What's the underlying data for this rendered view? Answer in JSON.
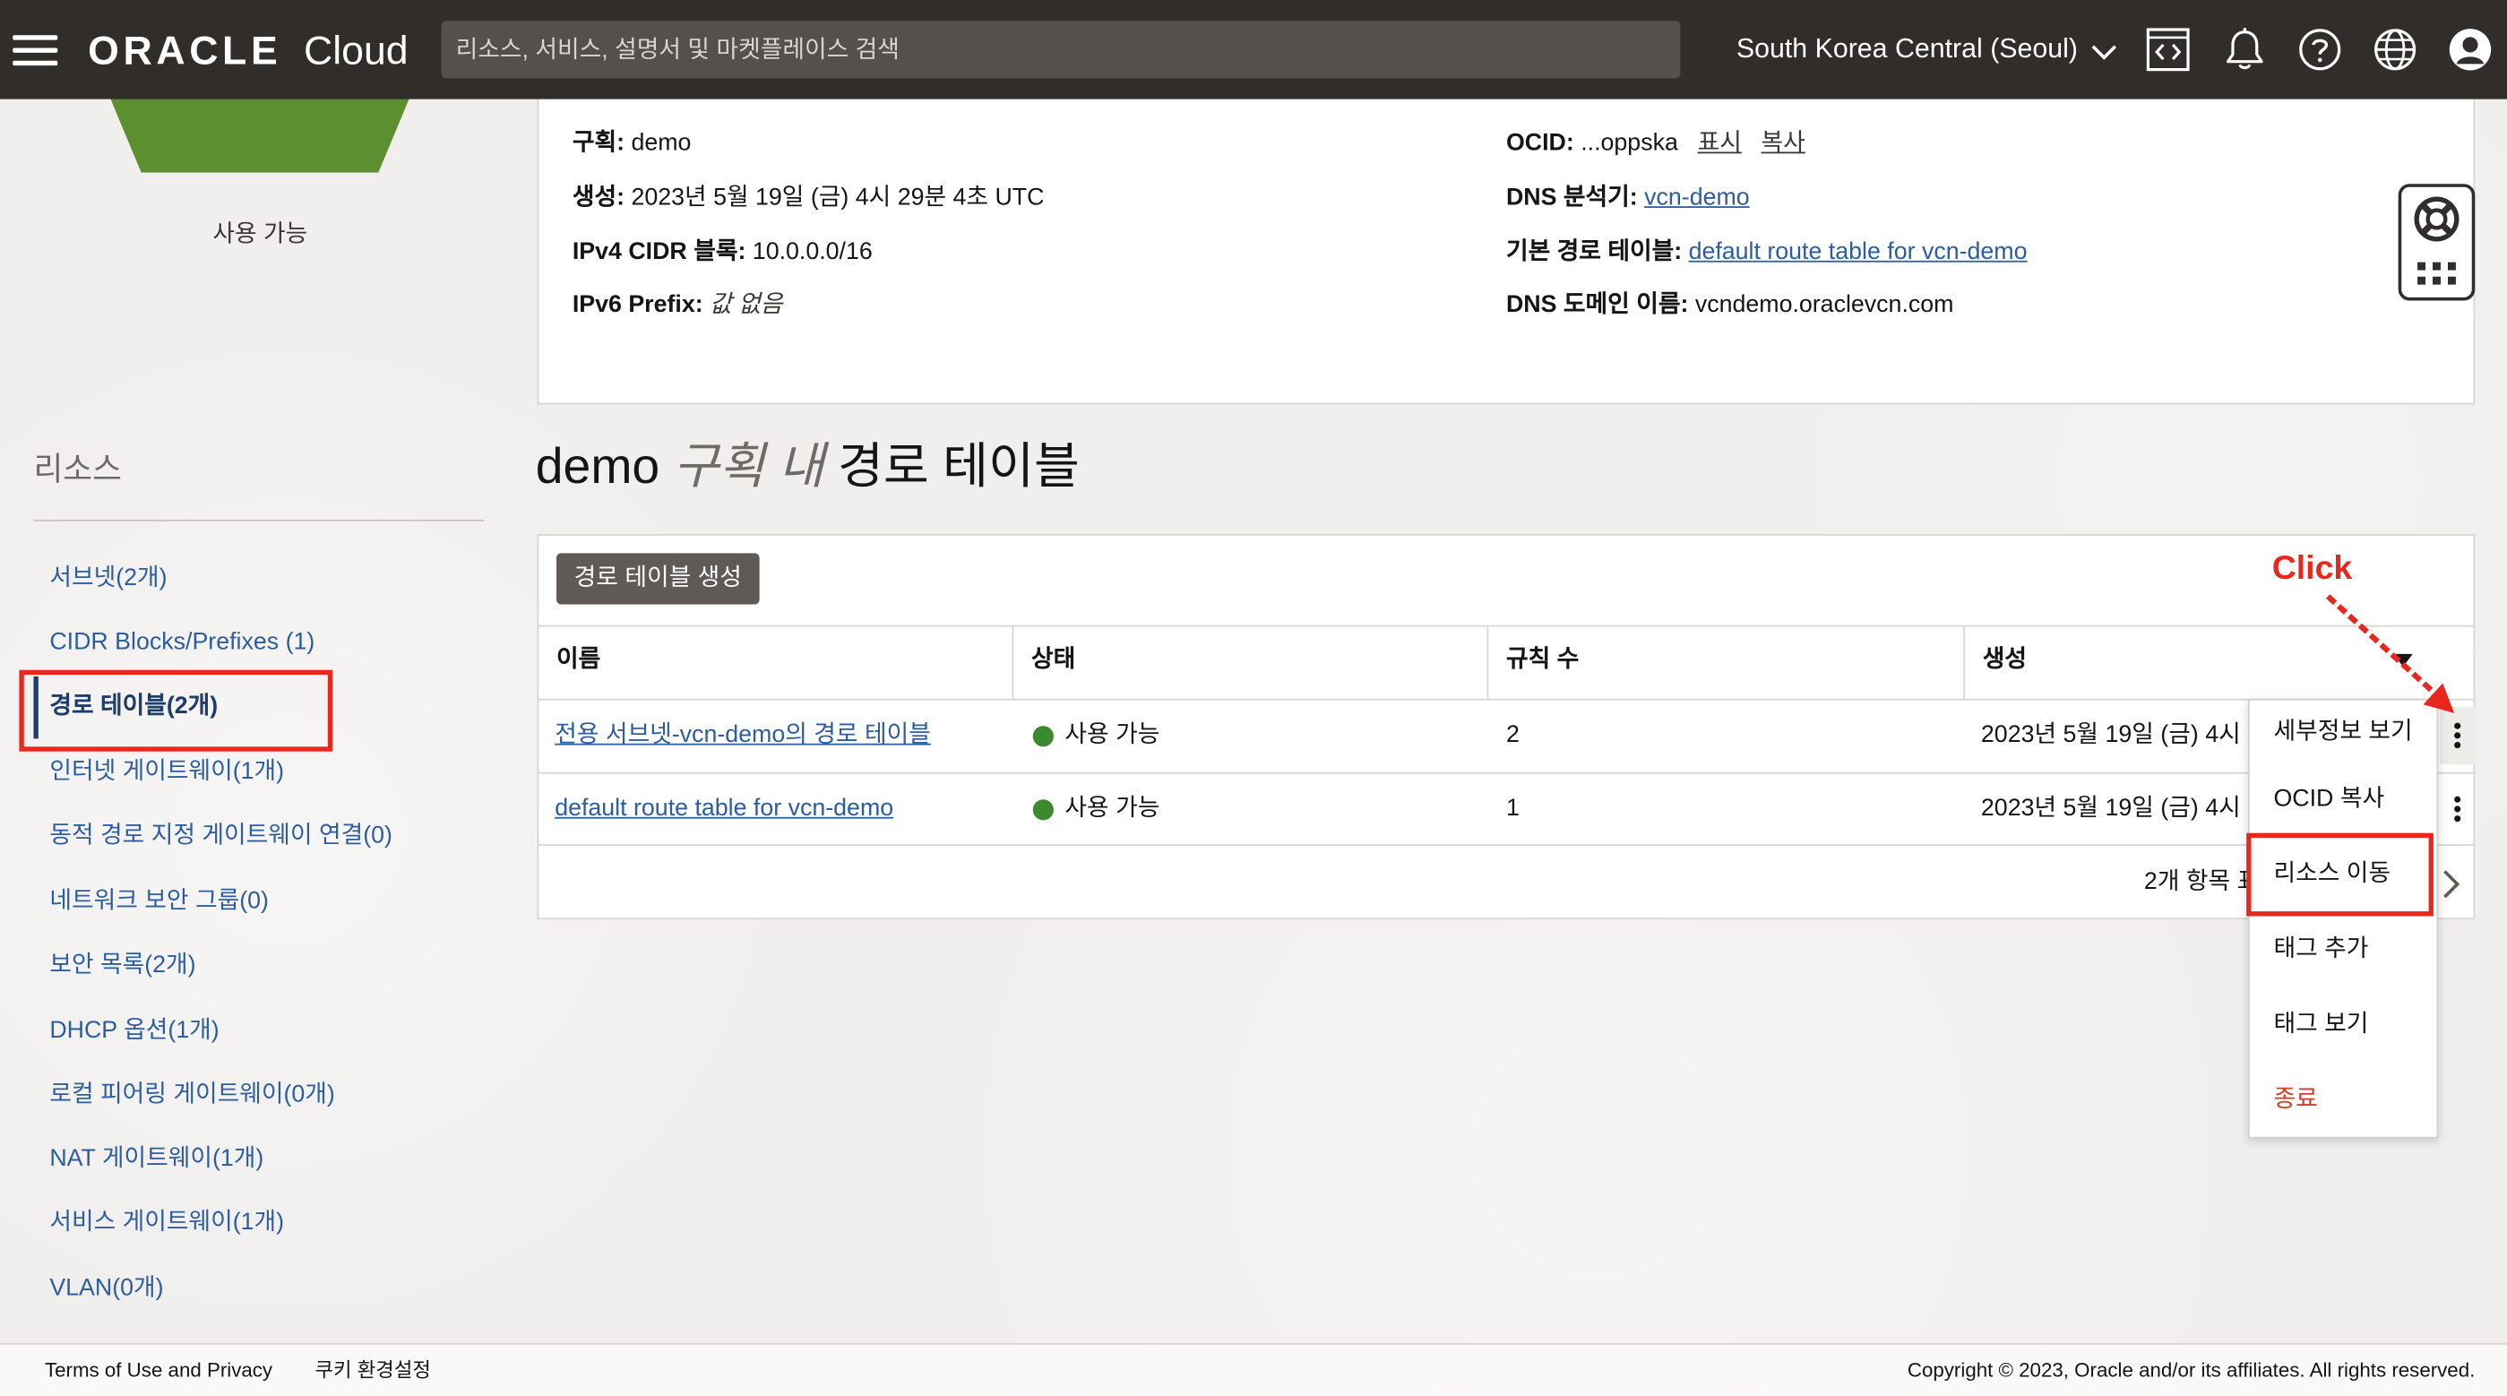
{
  "header": {
    "logo_brand": "ORACLE",
    "logo_product": "Cloud",
    "search_placeholder": "리소스, 서비스, 설명서 및 마켓플레이스 검색",
    "region": "South Korea Central (Seoul)",
    "icons": [
      "menu-icon",
      "code-editor-icon",
      "bell-icon",
      "help-icon",
      "globe-icon",
      "user-icon"
    ],
    "background": "#312d2a"
  },
  "sidebar": {
    "status_label": "사용 가능",
    "status_color": "#5b8f2f",
    "resources_title": "리소스",
    "items": [
      {
        "label": "서브넷(2개)",
        "active": false
      },
      {
        "label": "CIDR Blocks/Prefixes (1)",
        "active": false
      },
      {
        "label": "경로 테이블(2개)",
        "active": true
      },
      {
        "label": "인터넷 게이트웨이(1개)",
        "active": false
      },
      {
        "label": "동적 경로 지정 게이트웨이 연결(0)",
        "active": false
      },
      {
        "label": "네트워크 보안 그룹(0)",
        "active": false
      },
      {
        "label": "보안 목록(2개)",
        "active": false
      },
      {
        "label": "DHCP 옵션(1개)",
        "active": false
      },
      {
        "label": "로컬 피어링 게이트웨이(0개)",
        "active": false
      },
      {
        "label": "NAT 게이트웨이(1개)",
        "active": false
      },
      {
        "label": "서비스 게이트웨이(1개)",
        "active": false
      },
      {
        "label": "VLAN(0개)",
        "active": false
      }
    ]
  },
  "info": {
    "compartment": {
      "label": "구획:",
      "value": "demo"
    },
    "created": {
      "label": "생성:",
      "value": "2023년 5월 19일 (금) 4시 29분 4초 UTC"
    },
    "ipv4": {
      "label": "IPv4 CIDR 블록:",
      "value": "10.0.0.0/16"
    },
    "ipv6": {
      "label": "IPv6 Prefix:",
      "value": "값 없음"
    },
    "ocid": {
      "label": "OCID:",
      "value": "...oppska",
      "show": "표시",
      "copy": "복사"
    },
    "dns_resolver": {
      "label": "DNS 분석기:",
      "value": "vcn-demo"
    },
    "default_route": {
      "label": "기본 경로 테이블:",
      "value": "default route table for vcn-demo"
    },
    "dns_domain": {
      "label": "DNS 도메인 이름:",
      "value": "vcndemo.oraclevcn.com"
    }
  },
  "main": {
    "title_name": "demo",
    "title_scope": "구획 내",
    "title_resource": "경로 테이블",
    "create_button": "경로 테이블 생성",
    "columns": [
      "이름",
      "상태",
      "규칙 수",
      "생성"
    ],
    "rows": [
      {
        "name": "전용 서브넷-vcn-demo의 경로 테이블",
        "status": "사용 가능",
        "rules": "2",
        "created": "2023년 5월 19일 (금) 4시"
      },
      {
        "name": "default route table for vcn-demo",
        "status": "사용 가능",
        "rules": "1",
        "created": "2023년 5월 19일 (금) 4시"
      }
    ],
    "status_color": "#3c8a2e",
    "footer_count": "2개 항목 표"
  },
  "row_menu": {
    "items": [
      "세부정보 보기",
      "OCID 복사",
      "리소스 이동",
      "태그 추가",
      "태그 보기",
      "종료"
    ],
    "danger_color": "#d63b25"
  },
  "annotation": {
    "label": "Click",
    "color": "#e8281e"
  },
  "footer": {
    "terms": "Terms of Use and Privacy",
    "cookies": "쿠키 환경설정",
    "copyright": "Copyright © 2023, Oracle and/or its affiliates. All rights reserved."
  }
}
